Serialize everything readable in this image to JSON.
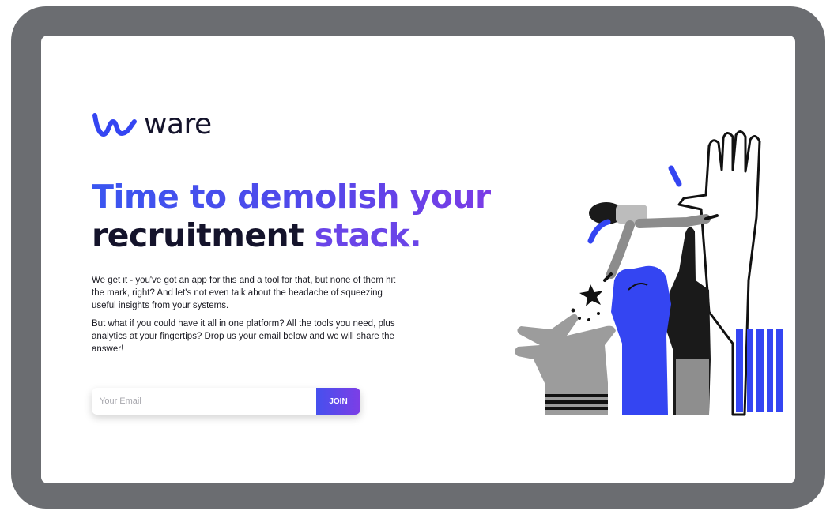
{
  "brand": {
    "name": "ware",
    "accent": "#3445f2",
    "accent_purple": "#7b3ce6",
    "dark": "#14132b",
    "frame_gray": "#6b6d71"
  },
  "hero": {
    "headline_line1": "Time to demolish your",
    "headline_line2_a": "recruitment",
    "headline_line2_b": "stack.",
    "paragraph1": "We get it - you've got an app for this and a tool for that, but none of them hit the mark, right? And let's not even talk about the headache of squeezing useful insights from your systems.",
    "paragraph2": "But what if you could have it all in one platform? All the tools you need, plus analytics at your fingertips? Drop us your email below and we will share the answer!"
  },
  "form": {
    "email_placeholder": "Your Email",
    "join_label": "JOIN"
  },
  "illustration": {
    "icon": "hands-lifting-person-illustration"
  }
}
